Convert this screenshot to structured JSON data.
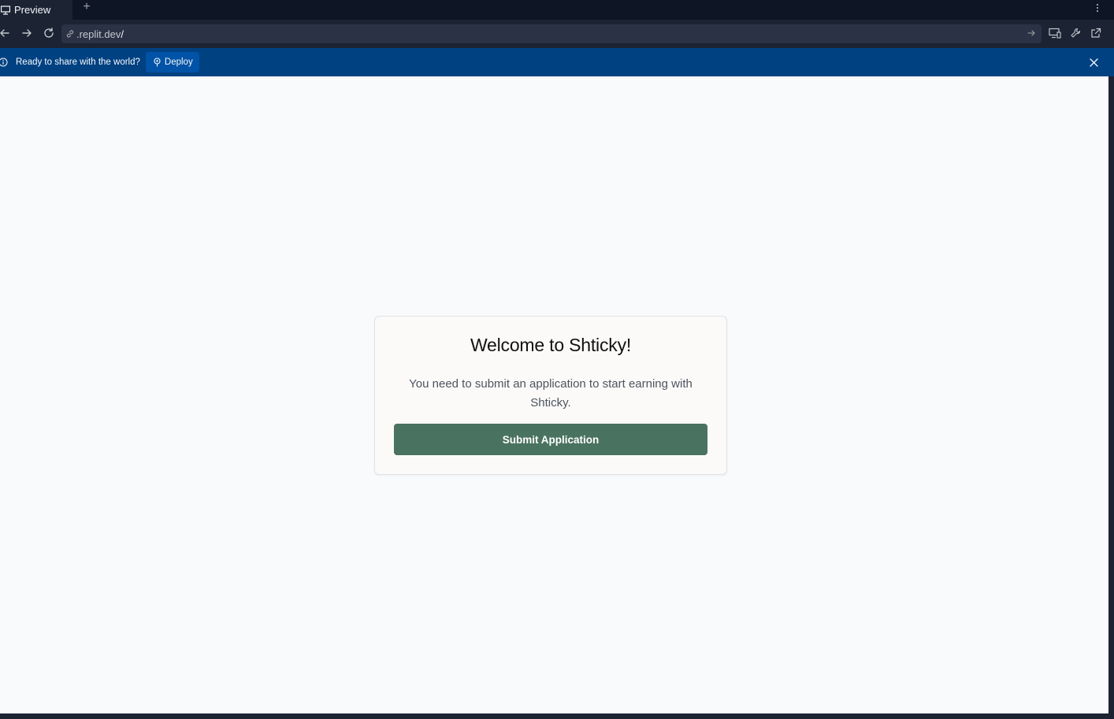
{
  "tabbar": {
    "tab_label": "Preview",
    "tab_icon": "monitor-icon",
    "new_tab_label": "+"
  },
  "address": {
    "url": ".replit.dev",
    "url_suffix": "/"
  },
  "banner": {
    "message": "Ready to share with the world?",
    "deploy_label": "Deploy",
    "color": "#004182"
  },
  "card": {
    "title": "Welcome to Shticky!",
    "body": "You need to submit an application to start earning with Shticky.",
    "button_label": "Submit Application",
    "button_color": "#4a7261"
  }
}
